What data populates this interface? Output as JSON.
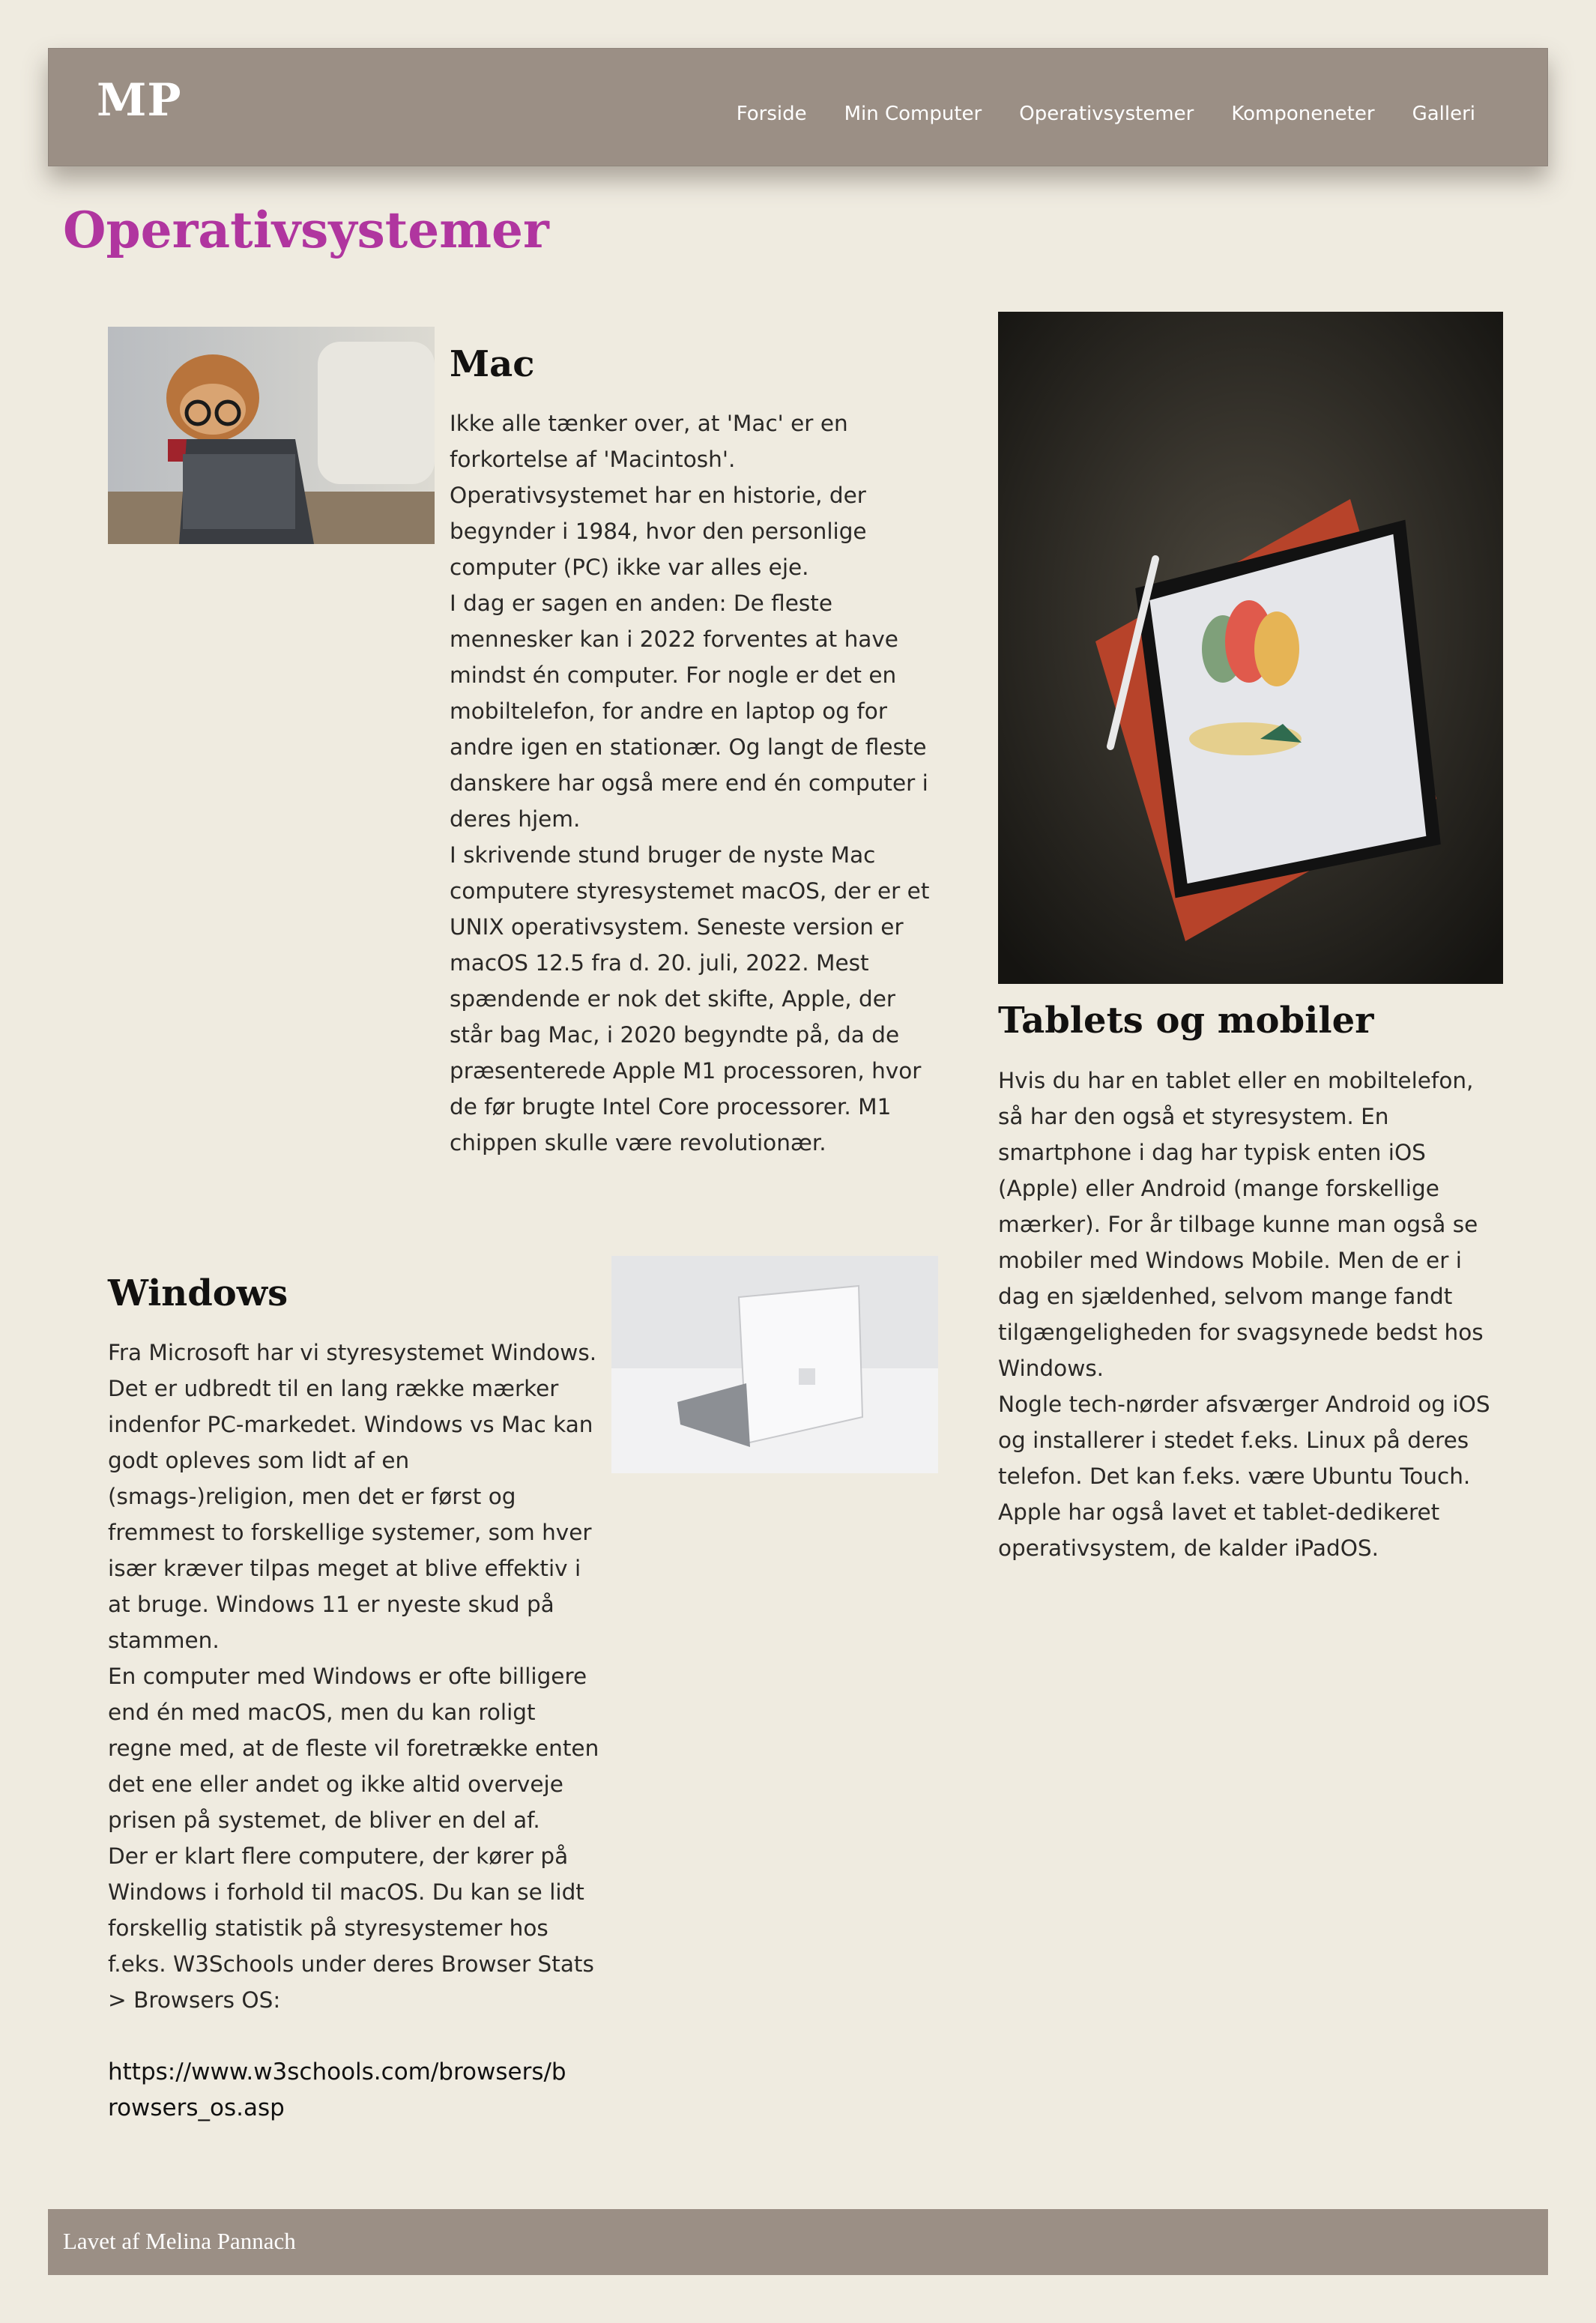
{
  "header": {
    "logo": "MP",
    "nav": [
      "Forside",
      "Min Computer",
      "Operativsystemer",
      "Komponeneter",
      "Galleri"
    ]
  },
  "page": {
    "title": "Operativsystemer"
  },
  "mac": {
    "heading": "Mac",
    "paragraphs": [
      "Ikke alle tænker over, at 'Mac' er en forkortelse af 'Macintosh'. Operativsystemet har en historie, der begynder i 1984, hvor den personlige computer (PC) ikke var alles eje.",
      "I dag er sagen en anden: De fleste mennesker kan i 2022 forventes at have mindst én computer. For nogle er det en mobiltelefon, for andre en laptop og for andre igen en stationær. Og langt de fleste danskere har også mere end én computer i deres hjem.",
      "I skrivende stund bruger de nyste Mac computere styresystemet macOS, der er et UNIX operativsystem. Seneste version er macOS 12.5 fra d. 20. juli, 2022. Mest spændende er nok det skifte, Apple, der står bag Mac, i 2020 begyndte på, da de præsenterede Apple M1 processoren, hvor de før brugte Intel Core processorer. M1 chippen skulle være revolutionær."
    ]
  },
  "windows": {
    "heading": "Windows",
    "paragraphs": [
      "Fra Microsoft har vi styresystemet Windows. Det er udbredt til en lang række mærker indenfor PC-markedet. Windows vs Mac kan godt opleves som lidt af en (smags-)religion, men det er først og fremmest to forskellige systemer, som hver især kræver tilpas meget at blive effektiv i at bruge. Windows 11 er nyeste skud på stammen.",
      "En computer med Windows er ofte billigere end én med macOS, men du kan roligt regne med, at de fleste vil foretrække enten det ene eller andet og ikke altid overveje prisen på systemet, de bliver en del af.",
      "Der er klart flere computere, der kører på Windows i forhold til macOS. Du kan se lidt forskellig statistik på styresystemer hos f.eks. W3Schools under deres Browser Stats > Browsers OS:"
    ],
    "link": "https://www.w3schools.com/browsers/browsers_os.asp"
  },
  "tablets": {
    "heading": "Tablets og mobiler",
    "paragraphs": [
      "Hvis du har en tablet eller en mobiltelefon, så har den også et styresystem. En smartphone i dag har typisk enten iOS (Apple) eller Android (mange forskellige mærker). For år tilbage kunne man også se mobiler med Windows Mobile. Men de er i dag en sjældenhed, selvom mange fandt tilgængeligheden for svagsynede bedst hos Windows.",
      "Nogle tech-nørder afsværger Android og iOS og installerer i stedet f.eks. Linux på deres telefon. Det kan f.eks. være Ubuntu Touch. Apple har også lavet et tablet-dedikeret operativsystem, de kalder iPadOS."
    ]
  },
  "footer": {
    "text": "Lavet af Melina Pannach"
  },
  "colors": {
    "header_bg": "#9b8f85",
    "page_bg": "#efebe0",
    "title": "#b0359f"
  }
}
